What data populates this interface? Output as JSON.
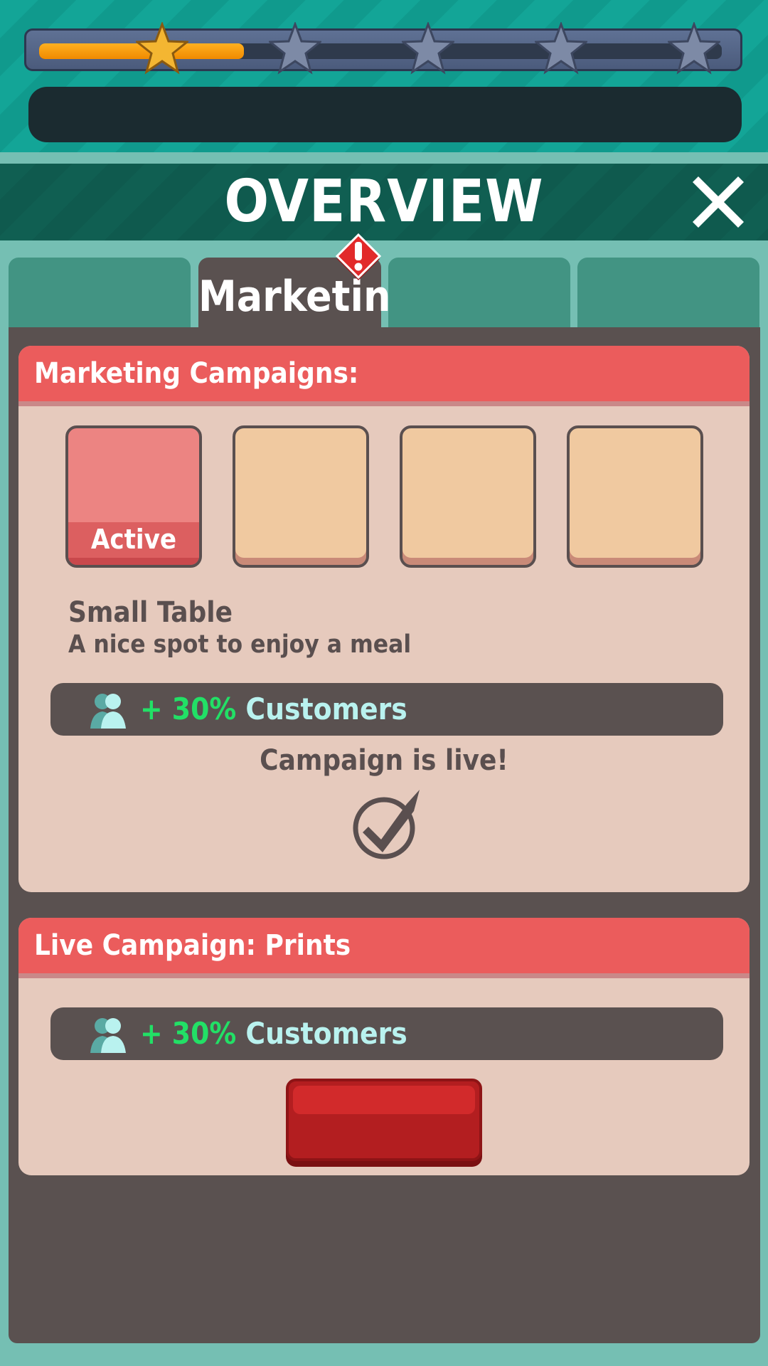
{
  "progress": {
    "fraction": 0.3,
    "stars_total": 5,
    "stars_earned": 1
  },
  "colors": {
    "star_gold": "#f4b632",
    "star_gray": "#7d8aa6",
    "accent_red": "#eb5c5c",
    "bonus_green": "#22e066",
    "bonus_cyan": "#b9f2ef"
  },
  "header": {
    "title": "OVERVIEW",
    "close_icon": "close-icon"
  },
  "tabs": [
    {
      "label": ""
    },
    {
      "label": "Marketing",
      "active": true,
      "alert_icon": "exclamation-icon"
    },
    {
      "label": ""
    },
    {
      "label": ""
    }
  ],
  "campaigns_card": {
    "title": "Marketing Campaigns:",
    "slots": [
      {
        "label": "Active",
        "state": "active"
      },
      {
        "label": "",
        "state": "empty"
      },
      {
        "label": "",
        "state": "empty"
      },
      {
        "label": "",
        "state": "empty"
      }
    ],
    "item_name": "Small Table",
    "item_description": "A nice spot to enjoy a meal",
    "bonus": {
      "icon": "customer-icon",
      "value": "+ 30%",
      "label": "Customers"
    },
    "status_text": "Campaign is live!",
    "status_icon": "checkmark-icon"
  },
  "live_card": {
    "title": "Live Campaign: Prints",
    "bonus": {
      "icon": "customer-icon",
      "value": "+ 30%",
      "label": "Customers"
    },
    "button_label": ""
  }
}
